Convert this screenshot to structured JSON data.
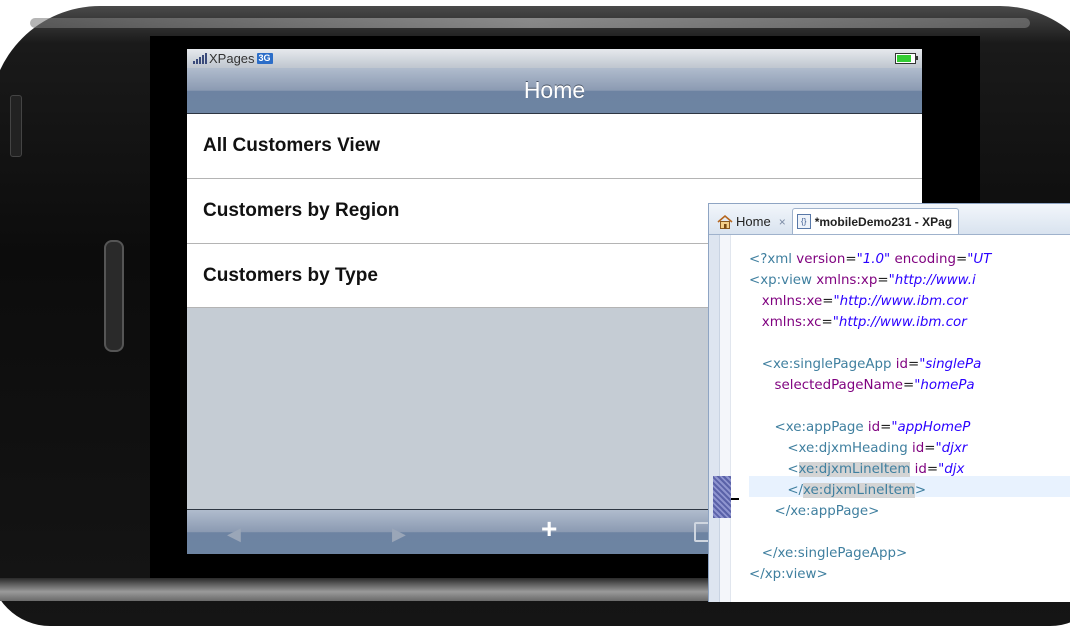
{
  "status_bar": {
    "carrier": "XPages",
    "network": "3G"
  },
  "nav_bar": {
    "title": "Home"
  },
  "list": {
    "items": [
      {
        "label": "All Customers View"
      },
      {
        "label": "Customers by Region"
      },
      {
        "label": "Customers by Type"
      }
    ]
  },
  "toolbar": {
    "back_label": "◀",
    "forward_label": "▶",
    "add_label": "+"
  },
  "editor": {
    "tabs": [
      {
        "label": "Home",
        "close": "×"
      },
      {
        "label": "*mobileDemo231 - XPag"
      }
    ],
    "code_lines": [
      {
        "tokens": [
          [
            "tg",
            "<?xml "
          ],
          [
            "an",
            "version"
          ],
          [
            "pl",
            "="
          ],
          [
            "av",
            "\"1.0\""
          ],
          [
            "pl",
            " "
          ],
          [
            "an",
            "encoding"
          ],
          [
            "pl",
            "="
          ],
          [
            "av",
            "\"UT"
          ]
        ]
      },
      {
        "tokens": [
          [
            "tg",
            "<xp:view "
          ],
          [
            "an",
            "xmlns:xp"
          ],
          [
            "pl",
            "="
          ],
          [
            "av",
            "\"http://www.i"
          ]
        ]
      },
      {
        "tokens": [
          [
            "pl",
            "   "
          ],
          [
            "an",
            "xmlns:xe"
          ],
          [
            "pl",
            "="
          ],
          [
            "av",
            "\"http://www.ibm.cor"
          ]
        ]
      },
      {
        "tokens": [
          [
            "pl",
            "   "
          ],
          [
            "an",
            "xmlns:xc"
          ],
          [
            "pl",
            "="
          ],
          [
            "av",
            "\"http://www.ibm.cor"
          ]
        ]
      },
      {
        "tokens": []
      },
      {
        "tokens": [
          [
            "pl",
            "   "
          ],
          [
            "tg",
            "<xe:singlePageApp "
          ],
          [
            "an",
            "id"
          ],
          [
            "pl",
            "="
          ],
          [
            "av",
            "\"singlePa"
          ]
        ]
      },
      {
        "tokens": [
          [
            "pl",
            "      "
          ],
          [
            "an",
            "selectedPageName"
          ],
          [
            "pl",
            "="
          ],
          [
            "av",
            "\"homePa"
          ]
        ]
      },
      {
        "tokens": []
      },
      {
        "tokens": [
          [
            "pl",
            "      "
          ],
          [
            "tg",
            "<xe:appPage "
          ],
          [
            "an",
            "id"
          ],
          [
            "pl",
            "="
          ],
          [
            "av",
            "\"appHomeP"
          ]
        ]
      },
      {
        "tokens": [
          [
            "pl",
            "         "
          ],
          [
            "tg",
            "<xe:djxmHeading "
          ],
          [
            "an",
            "id"
          ],
          [
            "pl",
            "="
          ],
          [
            "av",
            "\"djxr"
          ]
        ]
      },
      {
        "tokens": [
          [
            "pl",
            "         "
          ],
          [
            "tg",
            "<"
          ],
          [
            "tg hl",
            "xe:djxmLineItem"
          ],
          [
            "pl",
            " "
          ],
          [
            "an",
            "id"
          ],
          [
            "pl",
            "="
          ],
          [
            "av",
            "\"djx"
          ]
        ]
      },
      {
        "tokens": [
          [
            "pl",
            "         "
          ],
          [
            "tg",
            "</"
          ],
          [
            "tg hl",
            "xe:djxmLineItem"
          ],
          [
            "tg",
            ">"
          ]
        ]
      },
      {
        "tokens": [
          [
            "pl",
            "      "
          ],
          [
            "tg",
            "</xe:appPage>"
          ]
        ]
      },
      {
        "tokens": []
      },
      {
        "tokens": [
          [
            "pl",
            "   "
          ],
          [
            "tg",
            "</xe:singlePageApp>"
          ]
        ]
      },
      {
        "tokens": [
          [
            "tg",
            "</xp:view>"
          ]
        ]
      }
    ]
  }
}
